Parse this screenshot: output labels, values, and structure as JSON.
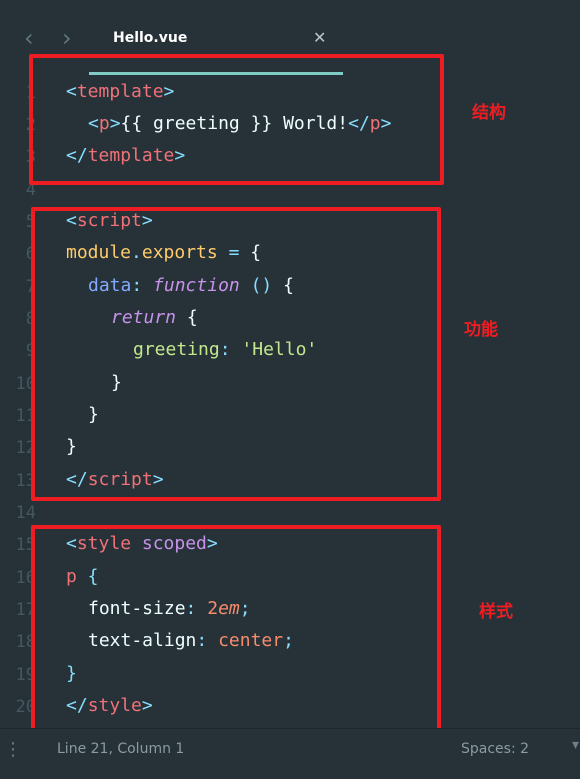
{
  "tab": {
    "back_icon": "chevron-left-icon",
    "forward_icon": "chevron-right-icon",
    "title": "Hello.vue",
    "close_icon": "close-icon"
  },
  "gutter": {
    "line_numbers": [
      "1",
      "2",
      "3",
      "4",
      "5",
      "6",
      "7",
      "8",
      "9",
      "10",
      "11",
      "12",
      "13",
      "14",
      "15",
      "16",
      "17",
      "18",
      "19",
      "20"
    ]
  },
  "code": {
    "l1": [
      "<",
      "template",
      ">"
    ],
    "l2": [
      "<",
      "p",
      ">",
      "{{ greeting }} World!",
      "</",
      "p",
      ">"
    ],
    "l3": [
      "</",
      "template",
      ">"
    ],
    "l5": [
      "<",
      "script",
      ">"
    ],
    "l6": [
      "module",
      ".",
      "exports",
      " = ",
      "{"
    ],
    "l7": [
      "data",
      ": ",
      "function",
      " ",
      "()",
      " {"
    ],
    "l8": [
      "return",
      " {"
    ],
    "l9": [
      "greeting",
      ": ",
      "'Hello'"
    ],
    "l10": [
      "}"
    ],
    "l11": [
      "}"
    ],
    "l12": [
      "}"
    ],
    "l13": [
      "</",
      "script",
      ">"
    ],
    "l15": [
      "<",
      "style",
      " ",
      "scoped",
      ">"
    ],
    "l16": [
      "p",
      " {"
    ],
    "l17": [
      "font-size",
      ": ",
      "2",
      "em",
      ";"
    ],
    "l18": [
      "text-align",
      ": ",
      "center",
      ";"
    ],
    "l19": [
      "}"
    ],
    "l20": [
      "</",
      "style",
      ">"
    ]
  },
  "annotations": {
    "structure": "结构",
    "function": "功能",
    "style": "样式"
  },
  "colors": {
    "background": "#263238",
    "highlight_box": "#ee1d24",
    "tab_underline": "#80cbc4"
  },
  "status": {
    "menu_icon": "vertical-dots-icon",
    "position": "Line 21, Column 1",
    "spaces": "Spaces: 2",
    "chevron_icon": "chevron-down-icon"
  }
}
